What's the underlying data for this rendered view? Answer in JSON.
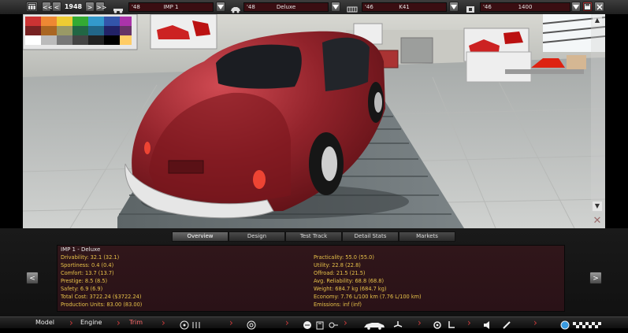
{
  "toolbar": {
    "year": "1948",
    "prev_label": "<",
    "prev_fast_label": "<<",
    "next_label": ">",
    "next_fast_label": ">>",
    "chassis": {
      "year": "'48",
      "name": "IMP 1"
    },
    "body": {
      "year": "'48",
      "name": "Deluxe"
    },
    "engine": {
      "year": "'46",
      "name": "K41"
    },
    "fuel": {
      "year": "'46",
      "name": "1400"
    }
  },
  "tabs": [
    {
      "label": "Overview",
      "active": true
    },
    {
      "label": "Design",
      "active": false
    },
    {
      "label": "Test Track",
      "active": false
    },
    {
      "label": "Detail Stats",
      "active": false
    },
    {
      "label": "Markets",
      "active": false
    }
  ],
  "panel": {
    "title": "IMP 1 - Deluxe",
    "left_stats": [
      "Drivability: 32.1 (32.1)",
      "Sportiness: 0.4 (0.4)",
      "Comfort: 13.7 (13.7)",
      "Prestige: 8.5 (8.5)",
      "Safety: 6.9 (6.9)",
      "Total Cost: 3722.24 ($3722.24)",
      "Production Units: 83.00 (83.00)"
    ],
    "right_stats": [
      "Practicality: 55.0 (55.0)",
      "Utility: 22.8 (22.8)",
      "Offroad: 21.5 (21.5)",
      "Avg. Reliability: 68.8 (68.8)",
      "Weight: 684.7 kg (684.7 kg)",
      "Economy: 7.76 L/100 km (7.76 L/100 km)",
      "Emissions: inf (inf)"
    ],
    "prev_label": "<",
    "next_label": ">"
  },
  "bottom_nav": {
    "model": "Model",
    "engine": "Engine",
    "trim": "Trim"
  },
  "colors": {
    "car": "#8e1c24",
    "field_bg": "#3a0e12",
    "stat_text": "#e8c24a",
    "active_nav": "#ff6a6a"
  }
}
